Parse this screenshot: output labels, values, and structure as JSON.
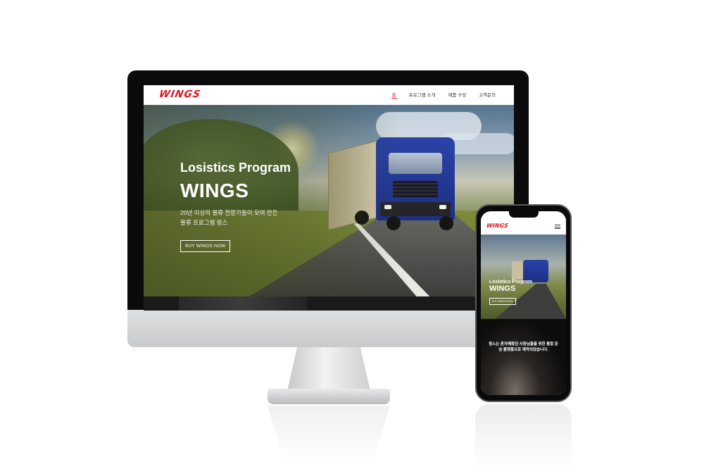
{
  "desktop": {
    "logo": "WINGS",
    "nav": {
      "items": [
        {
          "label": "홈",
          "active": true
        },
        {
          "label": "프로그램 소개",
          "active": false
        },
        {
          "label": "제품 구성",
          "active": false
        },
        {
          "label": "고객문의",
          "active": false
        }
      ]
    },
    "hero": {
      "subtitle": "Losistics Program",
      "title": "WINGS",
      "description": "20년 이상의 물류 전문가들이 모여 만든\n물류 프로그램 윙스",
      "button_label": "BUY WINGS NOW"
    }
  },
  "mobile": {
    "logo": "WINGS",
    "hero": {
      "subtitle": "Losistics Program",
      "title": "WINGS",
      "button_label": "BUY WINGS NOW"
    },
    "section": {
      "title": "윙스는 혼자해왔던 사장님들을 위한 통합 운송 플랫폼으로 제작되었습니다."
    }
  },
  "colors": {
    "brand_red": "#d71920",
    "dark_bg": "#0d0d0d"
  }
}
